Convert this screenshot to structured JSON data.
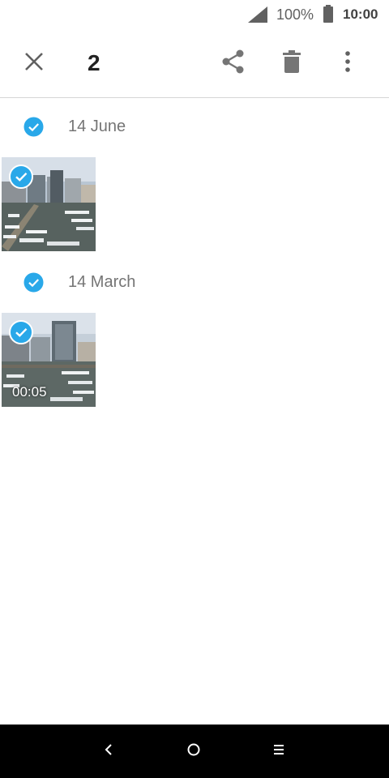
{
  "status_bar": {
    "battery_percent": "100%",
    "time": "10:00",
    "icons": [
      "signal-icon",
      "battery-icon"
    ]
  },
  "action_bar": {
    "selected_count": "2",
    "icons": [
      "close-icon",
      "share-icon",
      "delete-icon",
      "more-vert-icon"
    ]
  },
  "sections": [
    {
      "date": "14 June",
      "items": [
        {
          "type": "photo",
          "selected": true
        }
      ]
    },
    {
      "date": "14 March",
      "items": [
        {
          "type": "video",
          "selected": true,
          "duration": "00:05"
        }
      ]
    }
  ],
  "nav_bar": {
    "icons": [
      "back-icon",
      "home-icon",
      "recents-icon"
    ]
  },
  "colors": {
    "accent": "#29a8e9",
    "icon_gray": "#757575",
    "nav_bg": "#000000"
  }
}
